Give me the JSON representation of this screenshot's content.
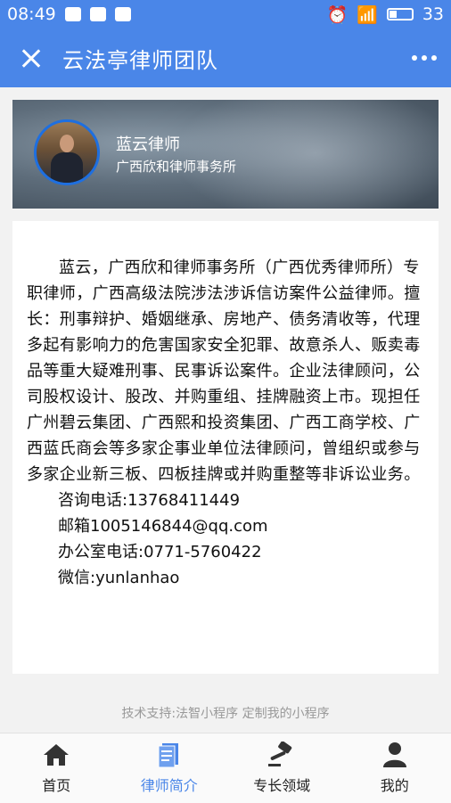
{
  "status_bar": {
    "time": "08:49",
    "battery": "33"
  },
  "app": {
    "title": "云法亭律师团队",
    "close_icon": "close-icon",
    "more_icon": "more-dots-icon"
  },
  "profile": {
    "name": "蓝云律师",
    "firm": "广西欣和律师事务所"
  },
  "intro": "蓝云，广西欣和律师事务所（广西优秀律师所）专职律师，广西高级法院涉法涉诉信访案件公益律师。擅长：刑事辩护、婚姻继承、房地产、债务清收等，代理多起有影响力的危害国家安全犯罪、故意杀人、贩卖毒品等重大疑难刑事、民事诉讼案件。企业法律顾问，公司股权设计、股改、并购重组、挂牌融资上市。现担任广州碧云集团、广西熙和投资集团、广西工商学校、广西蓝氏商会等多家企事业单位法律顾问，曾组织或参与多家企业新三板、四板挂牌或并购重整等非诉讼业务。",
  "contacts": {
    "phone": "咨询电话:13768411449",
    "email": "邮箱1005146844@qq.com",
    "office": "办公室电话:0771-5760422",
    "wechat": "微信:yunlanhao"
  },
  "support": "技术支持:法智小程序 定制我的小程序",
  "tabs": [
    {
      "label": "首页",
      "icon": "home-icon"
    },
    {
      "label": "律师简介",
      "icon": "document-icon",
      "active": true
    },
    {
      "label": "专长领域",
      "icon": "gavel-icon"
    },
    {
      "label": "我的",
      "icon": "user-icon"
    }
  ],
  "colors": {
    "primary": "#4a86e8",
    "avatar_border": "#1e6fe0"
  }
}
